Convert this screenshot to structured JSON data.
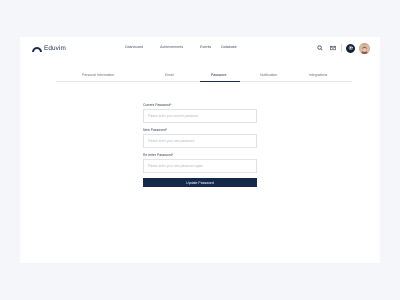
{
  "brand": {
    "name": "Eduvim",
    "color": "#1c2c4a"
  },
  "nav": {
    "items": [
      {
        "label": "Dashboard"
      },
      {
        "label": "Achievements"
      },
      {
        "label": "Events"
      },
      {
        "label": "Database"
      }
    ]
  },
  "header_icons": [
    "search-icon",
    "mail-icon",
    "gear-icon",
    "avatar"
  ],
  "tabs": {
    "items": [
      {
        "label": "Personal Information"
      },
      {
        "label": "Email"
      },
      {
        "label": "Password"
      },
      {
        "label": "Notification"
      },
      {
        "label": "Integrations"
      }
    ],
    "active": "Password"
  },
  "form": {
    "current_password": {
      "label": "Current Password*",
      "placeholder": "Please enter your current password",
      "value": ""
    },
    "new_password": {
      "label": "New Password*",
      "placeholder": "Please enter your new password",
      "value": ""
    },
    "confirm_password": {
      "label": "Re enter Password*",
      "placeholder": "Please enter your new password again",
      "value": ""
    },
    "submit_label": "Update Password"
  },
  "colors": {
    "background": "#f4f6fa",
    "card": "#ffffff",
    "primary": "#152a4a",
    "accent_gear": "#12213a"
  }
}
